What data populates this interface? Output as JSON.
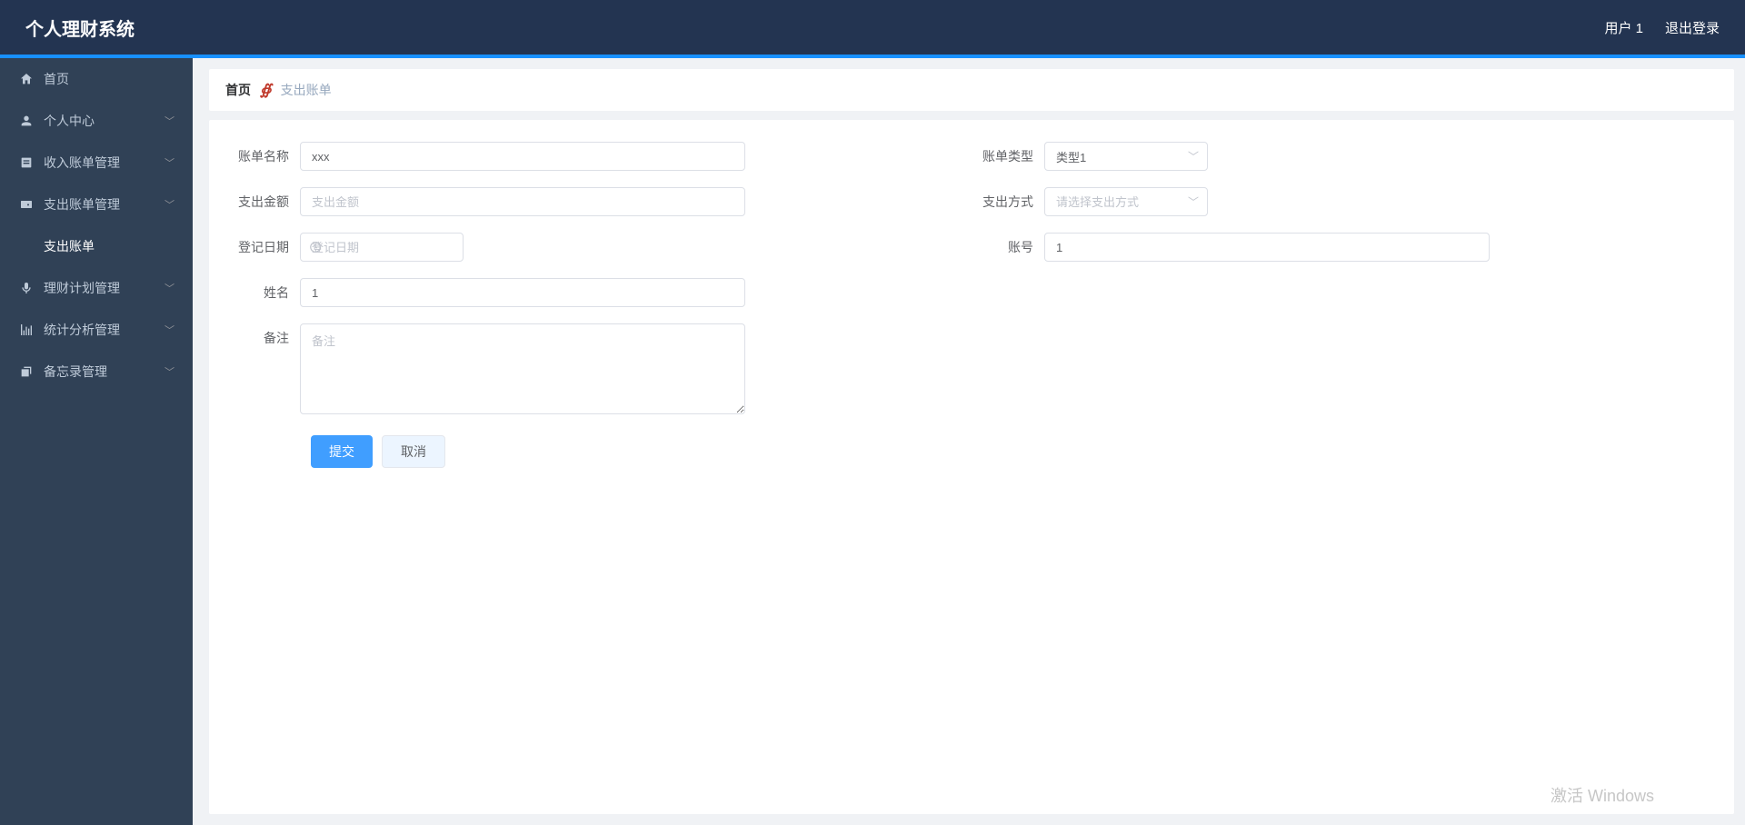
{
  "header": {
    "title": "个人理财系统",
    "user": "用户 1",
    "logout": "退出登录"
  },
  "sidebar": {
    "items": [
      {
        "label": "首页",
        "expandable": false
      },
      {
        "label": "个人中心",
        "expandable": true
      },
      {
        "label": "收入账单管理",
        "expandable": true
      },
      {
        "label": "支出账单管理",
        "expandable": true,
        "expanded": true,
        "children": [
          {
            "label": "支出账单"
          }
        ]
      },
      {
        "label": "理财计划管理",
        "expandable": true
      },
      {
        "label": "统计分析管理",
        "expandable": true
      },
      {
        "label": "备忘录管理",
        "expandable": true
      }
    ]
  },
  "breadcrumb": {
    "home": "首页",
    "current": "支出账单"
  },
  "form": {
    "bill_name_label": "账单名称",
    "bill_name_value": "xxx",
    "bill_type_label": "账单类型",
    "bill_type_value": "类型1",
    "amount_label": "支出金额",
    "amount_placeholder": "支出金额",
    "amount_value": "",
    "method_label": "支出方式",
    "method_placeholder": "请选择支出方式",
    "date_label": "登记日期",
    "date_placeholder": "登记日期",
    "account_label": "账号",
    "account_value": "1",
    "name_label": "姓名",
    "name_value": "1",
    "remark_label": "备注",
    "remark_placeholder": "备注",
    "remark_value": "",
    "submit": "提交",
    "cancel": "取消"
  },
  "watermark": "激活 Windows"
}
